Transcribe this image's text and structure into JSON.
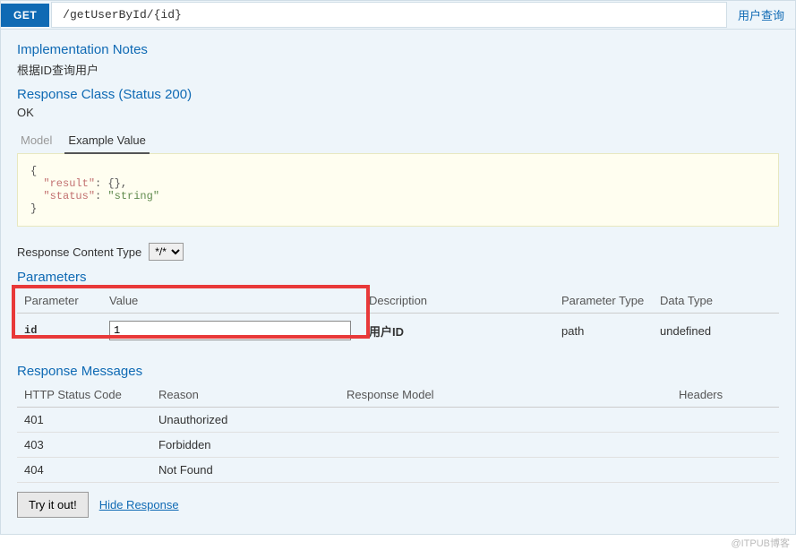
{
  "header": {
    "method": "GET",
    "path": "/getUserById/{id}",
    "summary": "用户查询"
  },
  "implNotes": {
    "title": "Implementation Notes",
    "text": "根据ID查询用户"
  },
  "responseClass": {
    "title": "Response Class (Status 200)",
    "statusText": "OK",
    "tabs": {
      "model": "Model",
      "example": "Example Value"
    },
    "exampleJson": "{\n  \"result\": {},\n  \"status\": \"string\"\n}"
  },
  "contentType": {
    "label": "Response Content Type",
    "selected": "*/*",
    "options": [
      "*/*"
    ]
  },
  "parameters": {
    "title": "Parameters",
    "headers": {
      "param": "Parameter",
      "value": "Value",
      "desc": "Description",
      "ptype": "Parameter Type",
      "dtype": "Data Type"
    },
    "rows": [
      {
        "name": "id",
        "value": "1",
        "desc": "用户ID",
        "ptype": "path",
        "dtype": "undefined"
      }
    ]
  },
  "responseMessages": {
    "title": "Response Messages",
    "headers": {
      "code": "HTTP Status Code",
      "reason": "Reason",
      "model": "Response Model",
      "hdrs": "Headers"
    },
    "rows": [
      {
        "code": "401",
        "reason": "Unauthorized",
        "model": "",
        "hdrs": ""
      },
      {
        "code": "403",
        "reason": "Forbidden",
        "model": "",
        "hdrs": ""
      },
      {
        "code": "404",
        "reason": "Not Found",
        "model": "",
        "hdrs": ""
      }
    ]
  },
  "actions": {
    "tryLabel": "Try it out!",
    "hideLabel": "Hide Response"
  },
  "watermark": "@ITPUB博客"
}
